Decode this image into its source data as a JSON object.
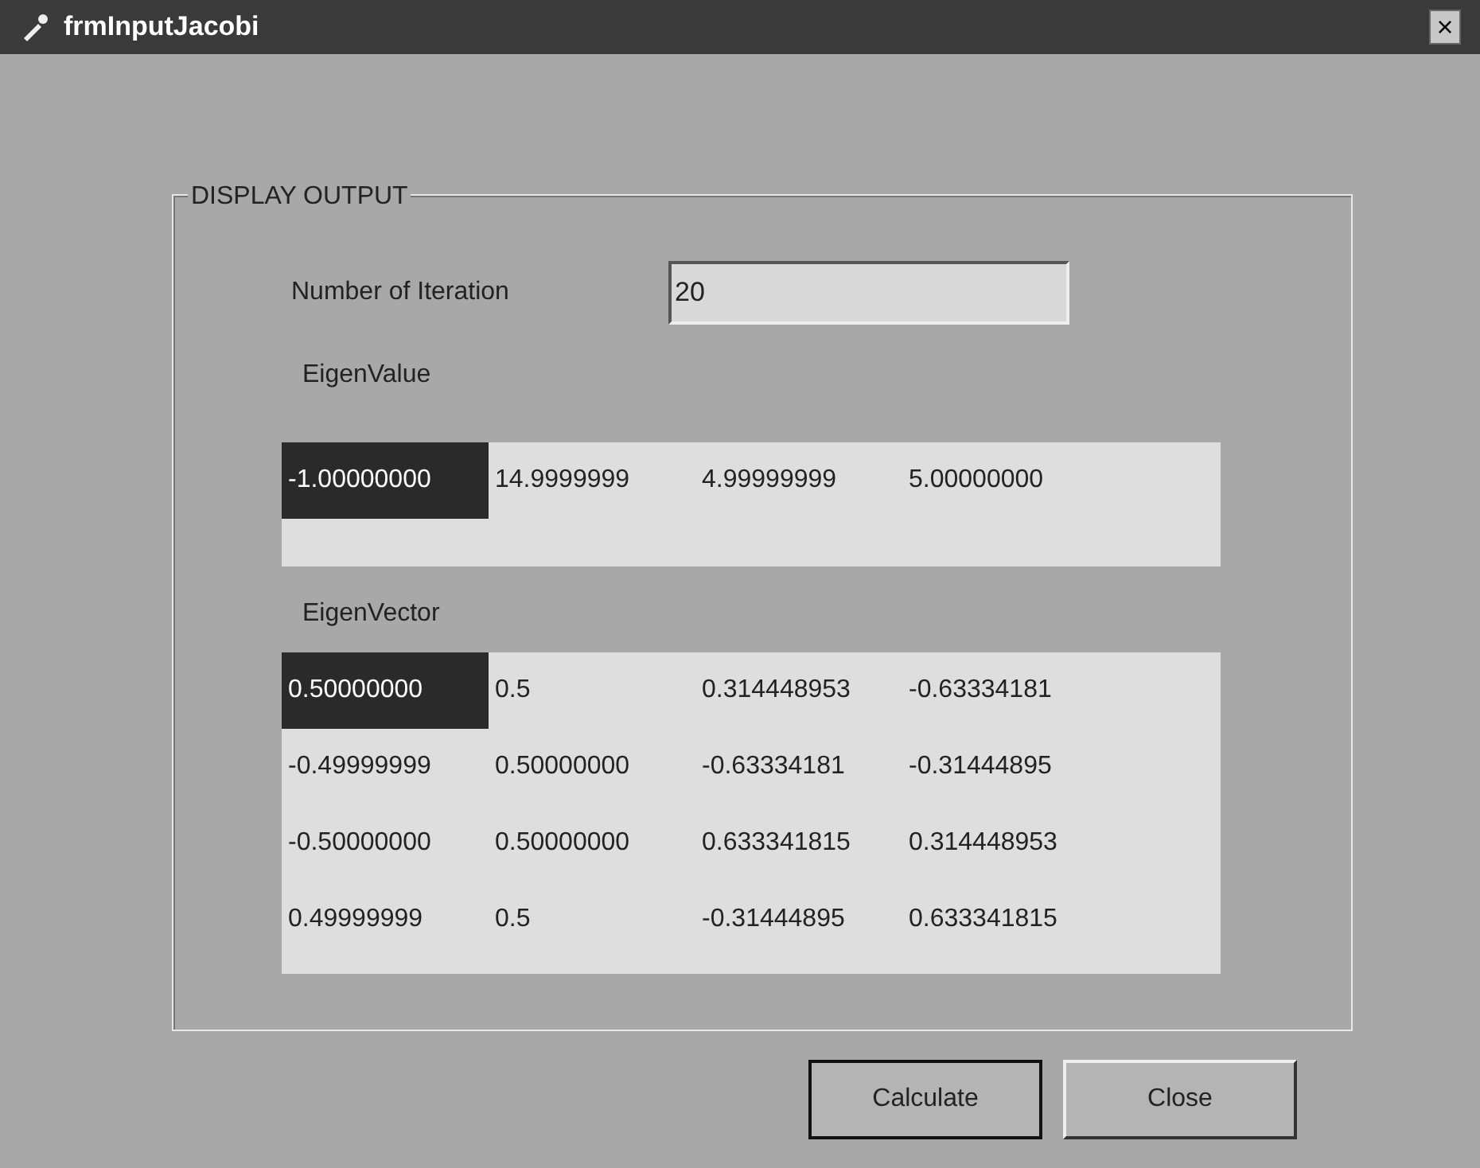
{
  "window": {
    "title": "frmInputJacobi",
    "close": "×"
  },
  "group": {
    "title": "DISPLAY OUTPUT"
  },
  "iteration": {
    "label": "Number of Iteration",
    "value": "20"
  },
  "eigen_value": {
    "label": "EigenValue",
    "rows": [
      [
        {
          "text": "-1.00000000",
          "selected": true
        },
        {
          "text": "14.9999999",
          "selected": false
        },
        {
          "text": "4.99999999",
          "selected": false
        },
        {
          "text": "5.00000000",
          "selected": false
        }
      ]
    ]
  },
  "eigen_vector": {
    "label": "EigenVector",
    "rows": [
      [
        {
          "text": "0.50000000",
          "selected": true
        },
        {
          "text": "0.5",
          "selected": false
        },
        {
          "text": "0.314448953",
          "selected": false
        },
        {
          "text": "-0.63334181",
          "selected": false
        }
      ],
      [
        {
          "text": "-0.49999999",
          "selected": false
        },
        {
          "text": "0.50000000",
          "selected": false
        },
        {
          "text": "-0.63334181",
          "selected": false
        },
        {
          "text": "-0.31444895",
          "selected": false
        }
      ],
      [
        {
          "text": "-0.50000000",
          "selected": false
        },
        {
          "text": "0.50000000",
          "selected": false
        },
        {
          "text": "0.633341815",
          "selected": false
        },
        {
          "text": "0.314448953",
          "selected": false
        }
      ],
      [
        {
          "text": "0.49999999",
          "selected": false
        },
        {
          "text": "0.5",
          "selected": false
        },
        {
          "text": "-0.31444895",
          "selected": false
        },
        {
          "text": "0.633341815",
          "selected": false
        }
      ]
    ]
  },
  "buttons": [
    {
      "label": "Calculate",
      "default": true
    },
    {
      "label": "Close",
      "default": false
    }
  ]
}
